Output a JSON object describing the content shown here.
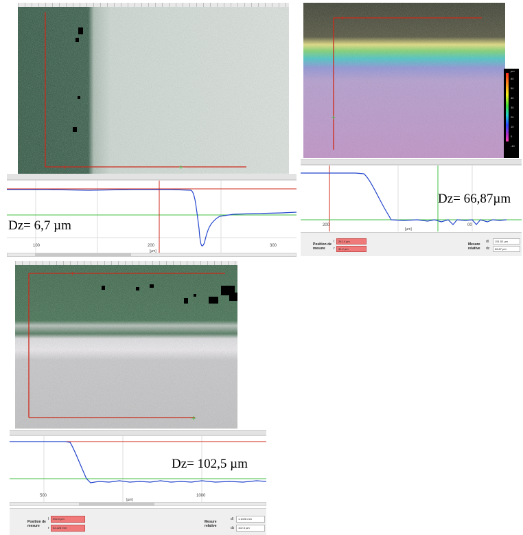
{
  "panels": [
    {
      "dz_label": "Dz= 6,7 µm",
      "x_ticks": [
        "100",
        "200",
        "300"
      ],
      "x_unit": "[µm]"
    },
    {
      "dz_label": "Dz= 66,87µm",
      "x_ticks": [
        "200",
        "00"
      ],
      "x_unit": "[µm]",
      "colorbar": {
        "unit": "µm",
        "ticks": [
          "60",
          "50",
          "40",
          "30",
          "20",
          "10",
          "0",
          "-10"
        ]
      },
      "status": {
        "position_label": "Position de mesure",
        "x_symbol": "l",
        "y_symbol": "r",
        "x_value": "241.4 µm",
        "y_value": "31.2 µm",
        "relative_label": "Mesure relative",
        "dl_symbol": "dl",
        "dz_symbol": "dz",
        "dl_value": "151.52 µm",
        "dz_value": "66.87 µm"
      }
    },
    {
      "dz_label": "Dz= 102,5 µm",
      "x_ticks": [
        "500",
        "1000"
      ],
      "x_unit": "[µm]",
      "status": {
        "position_label": "Position de mesure",
        "x_symbol": "l",
        "y_symbol": "r",
        "x_value": "902.0 µm",
        "y_value": "52.228 mm",
        "relative_label": "Mesure relative",
        "dl_symbol": "dl",
        "dz_symbol": "dz",
        "dl_value": "1.1028 mm",
        "dz_value": "102.5 µm"
      }
    }
  ],
  "colors": {
    "profile_line": "#2244cc",
    "cursor_red": "#cc2a1a",
    "cursor_green": "#3fbf3f",
    "grid": "#d9d9d9",
    "status_red": "#f07a7a"
  }
}
